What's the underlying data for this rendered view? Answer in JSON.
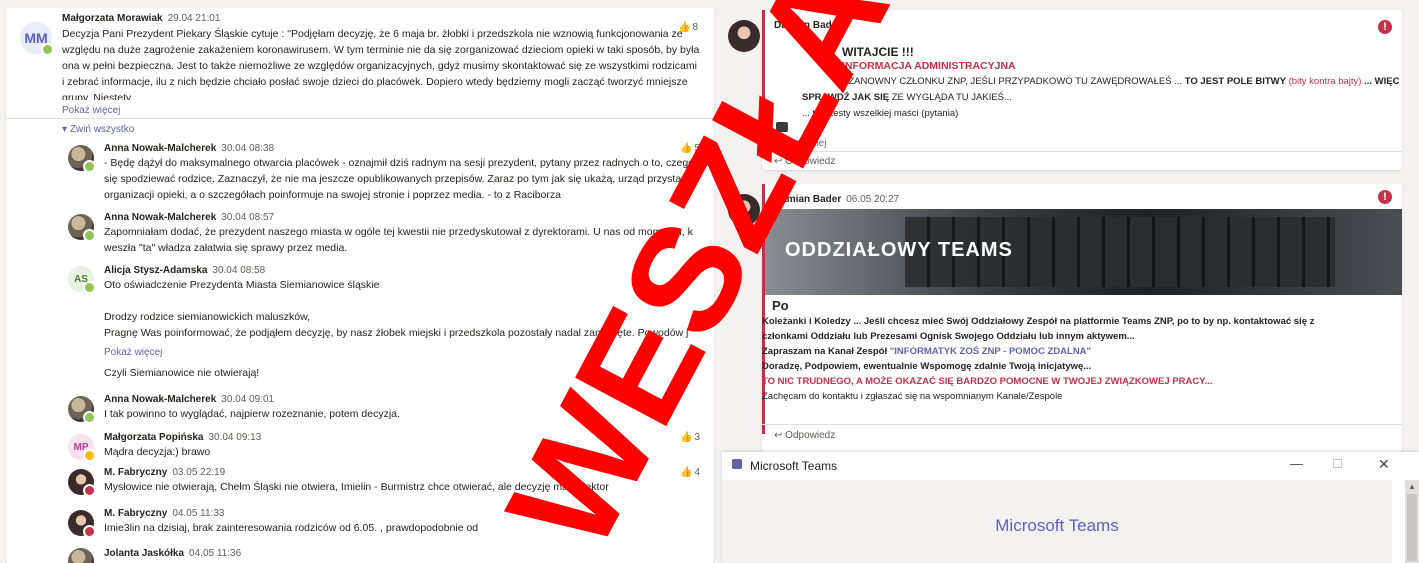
{
  "left": {
    "post": {
      "initials": "MM",
      "author": "Małgorzata Morawiak",
      "time": "29.04 21:01",
      "likes": "8",
      "body": "Decyzja Pani Prezydent Piekary Śląskie cytuje : \"Podjęłam decyzję, że 6 maja br. żłobki i przedszkola nie wznowią funkcjonowania ze względu na duże zagrożenie zakażeniem koronawirusem. W tym terminie nie da się zorganizować dzieciom opieki w taki sposób, by była ona w pełni bezpieczna. Jest to także niemożliwe ze względów organizacyjnych, gdyż musimy skontaktować się ze wszystkimi rodzicami i zebrać informacje, ilu z nich będzie chciało posłać swoje dzieci do placówek. Dopiero wtedy będziemy mogli zacząć tworzyć mniejsze grupy. Niestety...",
      "show_more": "Pokaż więcej",
      "collapse": "Zwiń wszystko"
    },
    "replies": [
      {
        "author": "Anna Nowak-Malcherek",
        "time": "30.04 08:38",
        "likes": "5",
        "lines": [
          "- Będę dążył do maksymalnego otwarcia placówek - oznajmił dziś radnym na sesji prezydent, pytany przez radnych o to, czego",
          "się spodziewać rodzice. Zaznaczył, że nie ma jeszcze opublikowanych przepisów. Zaraz po tym jak się ukażą, urząd przystąpi",
          "organizacji opieki, a o szczegółach poinformuje na swojej stronie i poprzez media. - to z Raciborza"
        ]
      },
      {
        "author": "Anna Nowak-Malcherek",
        "time": "30.04 08:57",
        "likes": "",
        "lines": [
          "Zapomniałam dodać, że prezydent naszego miasta w ogóle tej kwestii nie przedyskutował z dyrektorami. U nas od momentu, k",
          "weszła \"ta\" władza załatwia się sprawy przez media."
        ]
      },
      {
        "initials": "AS",
        "author": "Alicja Stysz-Adamska",
        "time": "30.04 08:58",
        "likes": "6",
        "lines": [
          "Oto oświadczenie Prezydenta Miasta Siemianowice śląskie",
          "",
          "Drodzy rodzice siemianowickich maluszków,",
          "Pragnę Was poinformować, że podjąłem decyzję, by nasz żłobek miejski i przedszkola pozostały nadal zamknięte. Powodów j"
        ],
        "show_more": "Pokaż więcej",
        "extra": "Czyli Siemianowice nie otwierają!"
      },
      {
        "author": "Anna Nowak-Malcherek",
        "time": "30.04 09:01",
        "likes": "",
        "lines": [
          "I tak powinno to wyglądać, najpierw rozeznanie, potem decyzja."
        ]
      },
      {
        "initials": "MP",
        "author": "Małgorzata Popińska",
        "time": "30.04 09:13",
        "likes": "3",
        "lines": [
          "Mądra decyzja:) brawo"
        ]
      },
      {
        "author": "M. Fabryczny",
        "time": "03.05 22:19",
        "likes": "4",
        "lines": [
          "Mysłowice nie otwierają, Chełm Śląski nie otwiera, Imielin - Burmistrz chce otwierać, ale decyzję ma dyrektor"
        ]
      },
      {
        "author": "M. Fabryczny",
        "time": "04.05 11:33",
        "likes": "",
        "lines": [
          "Imie3lin na dzisiaj, brak zainteresowania rodziców od 6.05. , prawdopodobnie od"
        ]
      },
      {
        "author": "Jolanta Jaskółka",
        "time": "04.05 11:36",
        "likes": "",
        "lines": [
          ""
        ]
      }
    ]
  },
  "right": {
    "post1": {
      "author": "Damian Bader",
      "heading": "WITAJCIE !!!",
      "info": "INFORMACJA ADMINISTRACYJNA",
      "line1_a": "SZANOWNY CZŁONKU ZNP, JEŚLI PRZYPADKOWO TU ZAWĘDROWAŁEŚ ... ",
      "line1_b": "TO JEST POLE BITWY",
      "line1_c": " (bity kontra bajty)",
      "line1_d": " ... WIĘC",
      "line2_a": "SPRAWDŹ",
      "line2_b": "JAK SIĘ",
      "line2_c": " ZE WYGLĄDA TU JAKIEŚ...",
      "line3": "... tzn. testy wszelkiej maści (pytania)",
      "show_more": "Pokaż mniej",
      "reply": "Odpowiedz"
    },
    "post2": {
      "author": "Damian Bader",
      "time": "06.05 20:27",
      "banner": "ODDZIAŁOWY TEAMS",
      "heading": "Po",
      "l1": "Koleżanki i Koledzy ... Jeśli chcesz mieć Swój Oddziałowy Zespół na platformie Teams ZNP, po to by np. kontaktować się z",
      "l2": "członkami Oddziału lub Prezesami Ognisk Swojego Oddziału lub innym aktywem...",
      "l3_a": "Zapraszam na Kanał Zespół ",
      "l3_b": "\"INFORMATYK ZOŚ ZNP - POMOC ZDALNA\"",
      "l4": "Doradzę, Podpowiem, ewentualnie Wspomogę zdalnie Twoją inicjatywę...",
      "l5": "TO NIC TRUDNEGO, A MOŻE OKAZAĆ SIĘ BARDZO POMOCNE W TWOJEJ ZWIĄZKOWEJ PRACY...",
      "l6": "Zachęcam do kontaktu i zgłaszać się na wspomnianym Kanale/Zespole",
      "reply": "Odpowiedz"
    }
  },
  "dialog": {
    "title": "Microsoft Teams",
    "brand": "Microsoft Teams",
    "minimize": "—",
    "maximize": "☐",
    "close": "✕"
  },
  "watermark": {
    "text": "WESZŁA CO!!!",
    "color": "#ff0000"
  }
}
